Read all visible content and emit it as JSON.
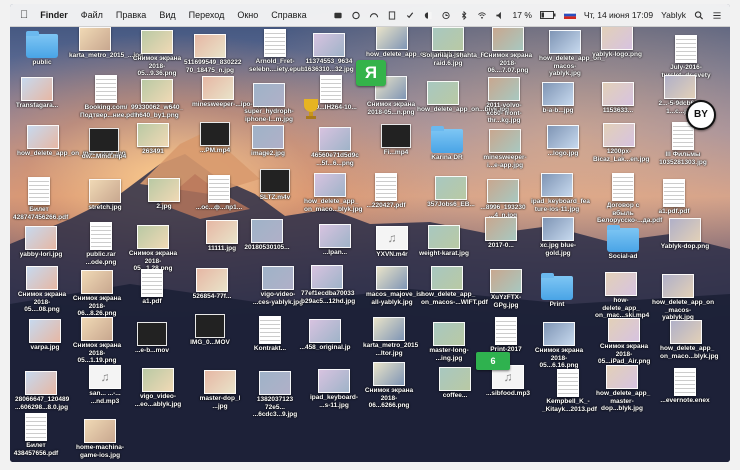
{
  "menubar": {
    "apple": "",
    "app": "Finder",
    "items": [
      "Файл",
      "Правка",
      "Вид",
      "Переход",
      "Окно",
      "Справка"
    ],
    "battery": "17 %",
    "datetime": "Чт, 14 июня  17:09",
    "user": "Yablyk"
  },
  "desktop_icons": [
    {
      "label": "public",
      "kind": "folder"
    },
    {
      "label": "karta_metro_2015_...jpg",
      "kind": "image"
    },
    {
      "label": "Снимок экрана 2018-05...9.36.png",
      "kind": "image"
    },
    {
      "label": "511699549_830222 70_18475_n.jpg",
      "kind": "image"
    },
    {
      "label": "Arnold_Fret- selebn....iety.epub",
      "kind": "doc"
    },
    {
      "label": "11374553_9634 1636310...32.jpg",
      "kind": "image"
    },
    {
      "label": "how_delete_app_on-...ablyk.jpg",
      "kind": "image"
    },
    {
      "label": "Soljaniaja_shahta_R raid.6.jpg",
      "kind": "image"
    },
    {
      "label": "Снимок экрана 2018-06....7.07.png",
      "kind": "image"
    },
    {
      "label": "how_delete_app_on_ macos-yablyk.jpg",
      "kind": "image"
    },
    {
      "label": "yablyk-logo.png",
      "kind": "image"
    },
    {
      "label": "July-2016-turslet- dr-svety",
      "kind": "doc"
    },
    {
      "label": "Transfagara...",
      "kind": "image"
    },
    {
      "label": "Booking.com/ Подтвер...ние.pdf",
      "kind": "doc"
    },
    {
      "label": "99330062_w640_ h640_by1.png",
      "kind": "image"
    },
    {
      "label": "minesweeper-...ipo-...jpg",
      "kind": "image"
    },
    {
      "label": "super_hydroph- iphone-l...m.jpg",
      "kind": "image"
    },
    {
      "label": "1140...IH264-10...",
      "kind": "doc"
    },
    {
      "label": "Снимок экрана 2018-05...n.png",
      "kind": "image"
    },
    {
      "label": "how_delete_app_on...blyk.jpg",
      "kind": "image"
    },
    {
      "label": "2011-volvo-xc60- front-thr...kg.jpg",
      "kind": "image"
    },
    {
      "label": "b-a-b...jpg",
      "kind": "image"
    },
    {
      "label": "1153633...",
      "kind": "image"
    },
    {
      "label": "2...-5-9dcb618 1...c...jpg",
      "kind": "image"
    },
    {
      "label": "how_delete_app_on_mac...blyk.jpg",
      "kind": "image"
    },
    {
      "label": "dw...Mmd.mp4",
      "kind": "video"
    },
    {
      "label": "263491",
      "kind": "image"
    },
    {
      "label": "...PM.mp4",
      "kind": "video"
    },
    {
      "label": "image2.jpg",
      "kind": "image"
    },
    {
      "label": "46560e71d5d9c ...5f...6...png",
      "kind": "image"
    },
    {
      "label": "Fi...mp4",
      "kind": "video"
    },
    {
      "label": "Karina DR",
      "kind": "folder"
    },
    {
      "label": "minesweeper-i...e-app.jpg",
      "kind": "image"
    },
    {
      "label": "...logo.jpg",
      "kind": "image"
    },
    {
      "label": "1200px- Bicaz_Lak...en.jpg",
      "kind": "image"
    },
    {
      "label": "III Фильмы 1035281303.jpg",
      "kind": "doc"
    },
    {
      "label": "Билет 428747456266.pdf",
      "kind": "doc"
    },
    {
      "label": "stretch.jpg",
      "kind": "image"
    },
    {
      "label": "2.jpg",
      "kind": "image"
    },
    {
      "label": "...ос...ф...пр1...",
      "kind": "doc"
    },
    {
      "label": "SLTZ.m4v",
      "kind": "video"
    },
    {
      "label": "how_delete_app_ on_maco...blyk.jpg",
      "kind": "image"
    },
    {
      "label": "...220427.pdf",
      "kind": "doc"
    },
    {
      "label": "357Jobs6_EB...",
      "kind": "image"
    },
    {
      "label": "...8996_193230 ...4_n.jpg",
      "kind": "image"
    },
    {
      "label": "ipad_keyboard_fea ture-ios-11.jpg",
      "kind": "image"
    },
    {
      "label": "Договор с вбыль Белорусско-...да.pdf",
      "kind": "doc"
    },
    {
      "label": "a1.pdf.pdf",
      "kind": "doc"
    },
    {
      "label": "yabby-lori.jpg",
      "kind": "image"
    },
    {
      "label": "public.rar ...ode.png",
      "kind": "doc"
    },
    {
      "label": "Снимок экрана 2018-05...1.28.png",
      "kind": "image"
    },
    {
      "label": "11111.jpg",
      "kind": "image"
    },
    {
      "label": "20180530105...",
      "kind": "image"
    },
    {
      "label": "...Ipan...",
      "kind": "image"
    },
    {
      "label": "YXVN.m4r",
      "kind": "audio"
    },
    {
      "label": "weight-karat.jpg",
      "kind": "image"
    },
    {
      "label": "2017-0...",
      "kind": "image"
    },
    {
      "label": "xc.jpg blue-gold.jpg",
      "kind": "image"
    },
    {
      "label": "Social-ad",
      "kind": "folder"
    },
    {
      "label": "Yablyk-dop.png",
      "kind": "image"
    },
    {
      "label": "Снимок экрана 2018-05....08.png",
      "kind": "image"
    },
    {
      "label": "Снимок экрана 2018-06...8.26.png",
      "kind": "image"
    },
    {
      "label": "a1.pdf",
      "kind": "doc"
    },
    {
      "label": "526854-77f...",
      "kind": "image"
    },
    {
      "label": "vigo-video- ...ces-yablyk.jpg",
      "kind": "image"
    },
    {
      "label": "77ef1ecdba70033 b29ac5...12hd.jpg",
      "kind": "image"
    },
    {
      "label": "macos_majove_ist all-yablyk.jpg",
      "kind": "image"
    },
    {
      "label": "how_delete_app_ on_macos-...WIFT.pdf",
      "kind": "image"
    },
    {
      "label": "XuYzFTX-GPg.jpg",
      "kind": "image"
    },
    {
      "label": "Print",
      "kind": "folder"
    },
    {
      "label": "how-delete_app_ on_mac...ski.mp4",
      "kind": "image"
    },
    {
      "label": "how_delete_app_on _macos-yablyk.jpg",
      "kind": "image"
    },
    {
      "label": "varpa.jpg",
      "kind": "image"
    },
    {
      "label": "Снимок экрана 2018-05...1.19.png",
      "kind": "image"
    },
    {
      "label": "...e-b...mov",
      "kind": "video"
    },
    {
      "label": "IMG_0...MOV",
      "kind": "video"
    },
    {
      "label": "Kontrakt...",
      "kind": "doc"
    },
    {
      "label": "...458_original.jp",
      "kind": "image"
    },
    {
      "label": "karta_metro_2015 ...ltor.jpg",
      "kind": "image"
    },
    {
      "label": "master-long- ...ing.jpg",
      "kind": "image"
    },
    {
      "label": "Print-2017",
      "kind": "doc"
    },
    {
      "label": "Снимок экрана 2018-05...6.16.png",
      "kind": "image"
    },
    {
      "label": "Снимок экрана 2018-05...iPad_Air.png",
      "kind": "image"
    },
    {
      "label": "how_delete_app_ on_maco...blyk.jpg",
      "kind": "image"
    },
    {
      "label": "28066647_120489 ...606298...8.0.jpg",
      "kind": "image"
    },
    {
      "label": "san... ...-... ...nd.mp3",
      "kind": "audio"
    },
    {
      "label": "vigo_video- ...eo...ablyk.jpg",
      "kind": "image"
    },
    {
      "label": "master-dop_l ...jpg",
      "kind": "image"
    },
    {
      "label": "1382037123 72e5... ...6cdc3...9.jpg",
      "kind": "image"
    },
    {
      "label": "ipad_keyboard- ...s-11.jpg",
      "kind": "image"
    },
    {
      "label": "Снимок экрана 2018-06...6266.png",
      "kind": "image"
    },
    {
      "label": "coffee...",
      "kind": "image"
    },
    {
      "label": "...sibfood.mp3",
      "kind": "audio"
    },
    {
      "label": "Kempbell_K_-_Kitayk...2013.pdf",
      "kind": "doc"
    },
    {
      "label": "how_delete_app_ master-dop...blyk.jpg",
      "kind": "image"
    },
    {
      "label": "...evernote.enex",
      "kind": "doc"
    },
    {
      "label": "Билет 438457656.pdf",
      "kind": "doc"
    },
    {
      "label": "home-machina- game-ios.jpg",
      "kind": "image"
    }
  ],
  "badge_texts": {
    "yablyk": "Я",
    "by": "BY",
    "six": "6"
  }
}
